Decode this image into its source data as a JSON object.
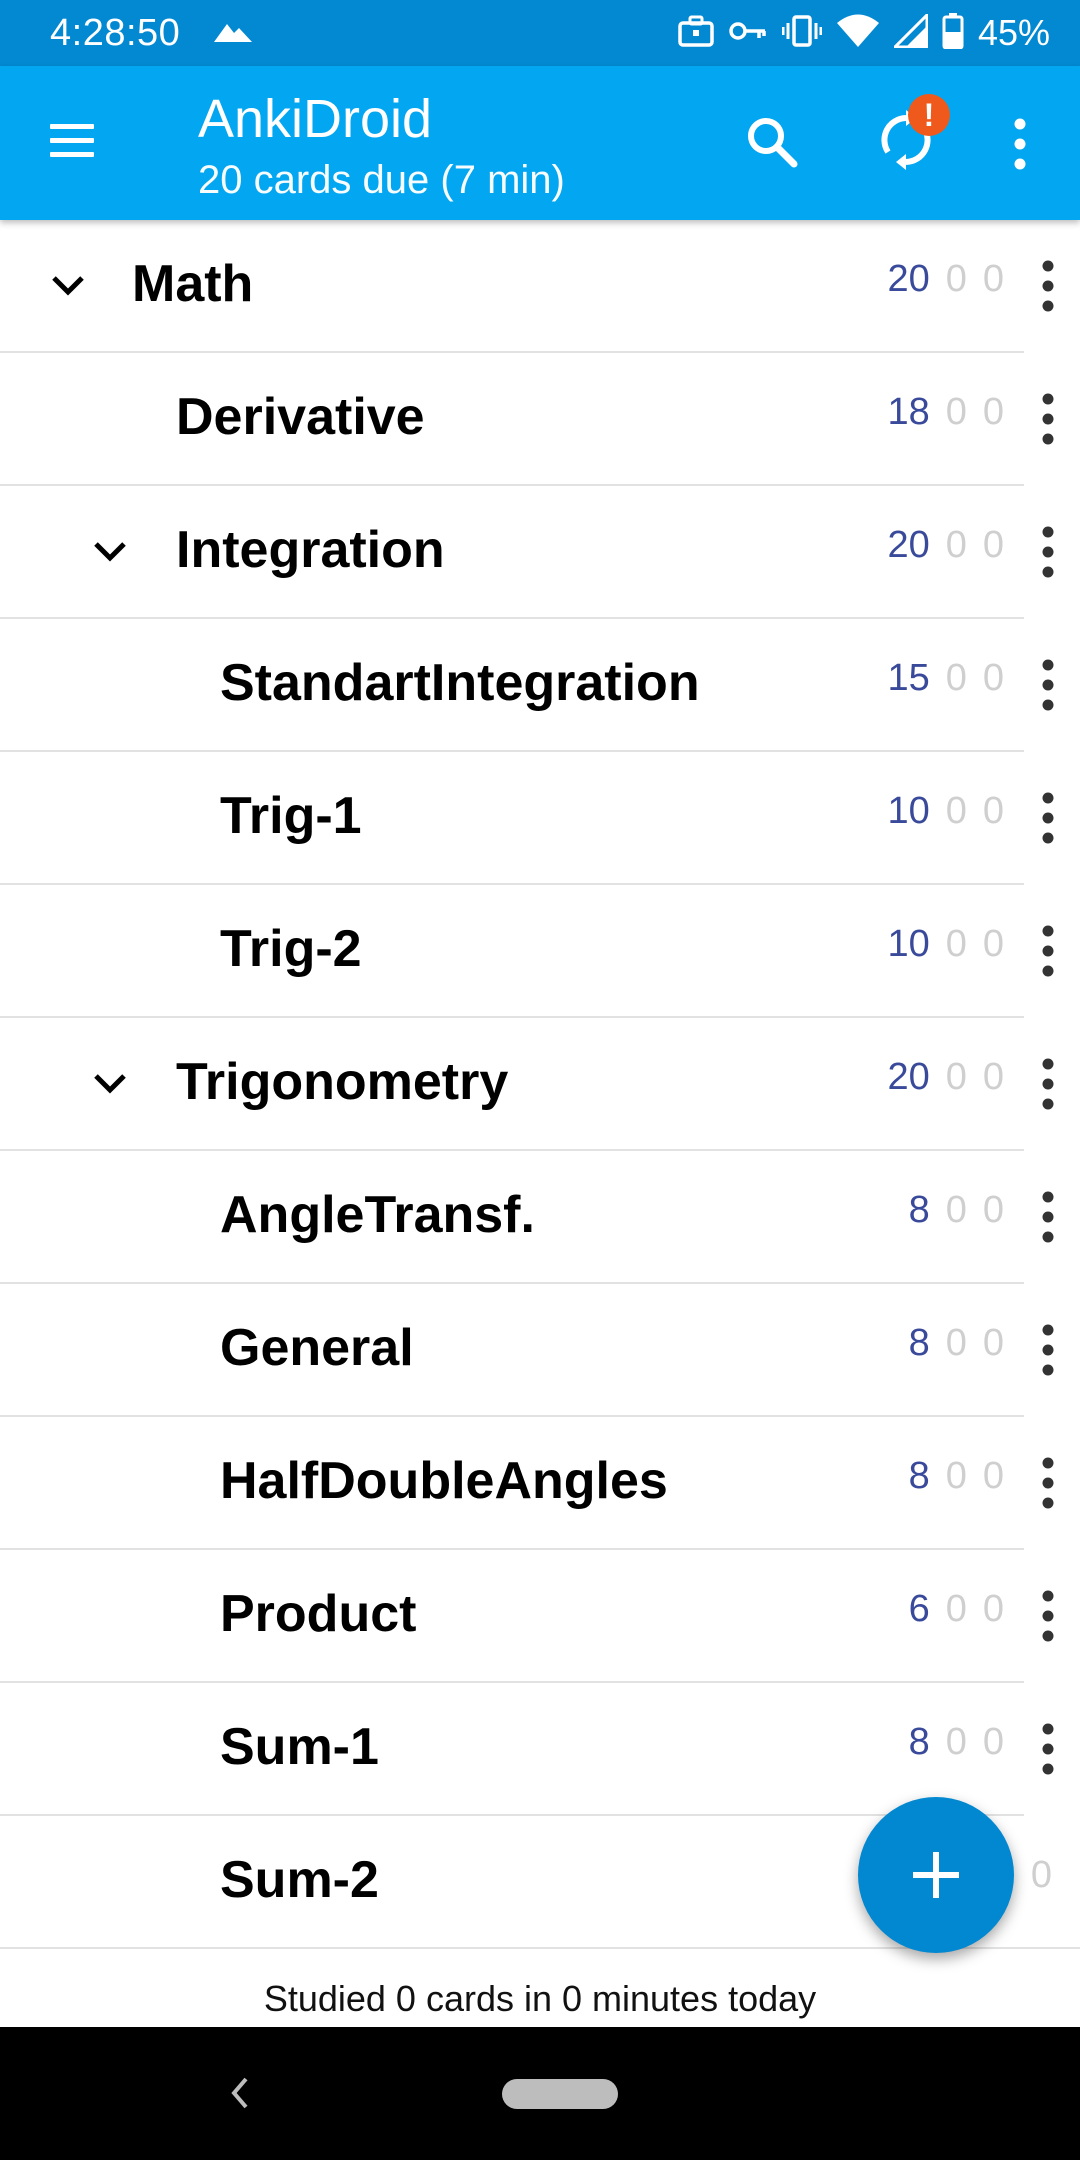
{
  "status_bar": {
    "time": "4:28:50",
    "battery": "45%",
    "icons": [
      "mountain-icon",
      "briefcase-icon",
      "key-icon",
      "vibrate-icon",
      "wifi-icon",
      "signal-icon",
      "battery-icon"
    ]
  },
  "app_bar": {
    "title": "AnkiDroid",
    "subtitle": "20 cards due (7 min)",
    "sync_badge": "!",
    "color": "#03a6f0",
    "status_color": "#0389d2"
  },
  "decks": [
    {
      "name": "Math",
      "counts": [
        "20",
        "0",
        "0"
      ],
      "expanded": true,
      "has_children": true
    },
    {
      "name": "Derivative",
      "counts": [
        "18",
        "0",
        "0"
      ],
      "has_children": false
    },
    {
      "name": "Integration",
      "counts": [
        "20",
        "0",
        "0"
      ],
      "expanded": true,
      "has_children": true
    },
    {
      "name": "StandartIntegration",
      "counts": [
        "15",
        "0",
        "0"
      ],
      "has_children": false
    },
    {
      "name": "Trig-1",
      "counts": [
        "10",
        "0",
        "0"
      ],
      "has_children": false
    },
    {
      "name": "Trig-2",
      "counts": [
        "10",
        "0",
        "0"
      ],
      "has_children": false
    },
    {
      "name": "Trigonometry",
      "counts": [
        "20",
        "0",
        "0"
      ],
      "expanded": true,
      "has_children": true
    },
    {
      "name": "AngleTransf.",
      "counts": [
        "8",
        "0",
        "0"
      ],
      "has_children": false
    },
    {
      "name": "General",
      "counts": [
        "8",
        "0",
        "0"
      ],
      "has_children": false
    },
    {
      "name": "HalfDoubleAngles",
      "counts": [
        "8",
        "0",
        "0"
      ],
      "has_children": false
    },
    {
      "name": "Product",
      "counts": [
        "6",
        "0",
        "0"
      ],
      "has_children": false
    },
    {
      "name": "Sum-1",
      "counts": [
        "8",
        "0",
        "0"
      ],
      "has_children": false
    },
    {
      "name": "Sum-2",
      "counts": [
        "",
        "",
        "0"
      ],
      "has_children": false
    }
  ],
  "footer": {
    "studied_text": "Studied 0 cards in 0 minutes today"
  },
  "fab": {
    "icon": "plus-icon",
    "color": "#0288d1"
  },
  "colors": {
    "due": "#3a4a9b",
    "zero": "#cfcfcf"
  }
}
